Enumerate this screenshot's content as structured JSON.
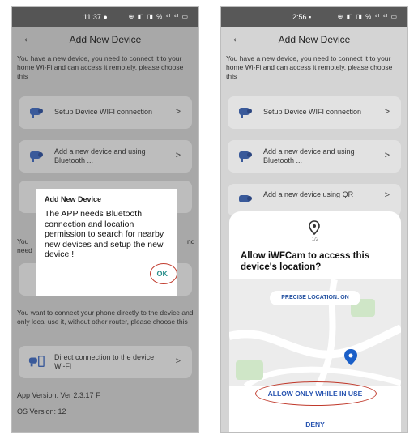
{
  "left": {
    "status": {
      "time": "11:37 ●",
      "icons": "⊕ ◧ ◨ ℅ ⁴ᴵ ⁴ᴵ ▭"
    },
    "header": {
      "title": "Add New Device",
      "back_icon": "back-arrow-icon"
    },
    "intro": "You have a new device, you need to connect it to your home Wi-Fi and can access it remotely, please choose this",
    "options": [
      {
        "label": "Setup Device WIFI connection",
        "icon": "camera-icon"
      },
      {
        "label": "Add a new device and using Bluetooth ...",
        "icon": "camera-icon"
      },
      {
        "label": "Direct connection to the device Wi-Fi",
        "icon": "camera-phone-icon"
      }
    ],
    "hidden_text_left": "You",
    "hidden_text_left2": "need",
    "hidden_text_right": "nd",
    "bottom_text": "You want to connect your phone directly to the device and only local use it, without other router, please choose this",
    "app_version": "App Version: Ver 2.3.17 F",
    "os_version": "OS Version: 12",
    "dialog": {
      "title": "Add New Device",
      "message": "The APP needs Bluetooth connection and location permission to search for nearby new devices and setup the new device !",
      "ok": "OK"
    }
  },
  "right": {
    "status": {
      "time": "2:56 ▪",
      "icons": "⊕ ◧ ◨ ℅ ⁴ᴵ ⁴ᴵ ▭"
    },
    "header": {
      "title": "Add New Device",
      "back_icon": "back-arrow-icon"
    },
    "intro": "You have a new device, you need to connect it to your home Wi-Fi and can access it remotely, please choose this",
    "options": [
      {
        "label": "Setup Device WIFI connection",
        "icon": "camera-icon"
      },
      {
        "label": "Add a new device and using Bluetooth ...",
        "icon": "camera-icon"
      },
      {
        "label": "Add a new device using QR",
        "icon": "camera-icon"
      }
    ],
    "permission": {
      "step": "1/2",
      "question": "Allow iWFCam to access this device's location?",
      "precise": "PRECISE LOCATION: ON",
      "allow": "ALLOW ONLY WHILE IN USE",
      "deny": "DENY"
    }
  },
  "colors": {
    "accent_teal": "#2a8f8c",
    "link_blue": "#2653b0",
    "highlight_ring": "#c0392b"
  }
}
